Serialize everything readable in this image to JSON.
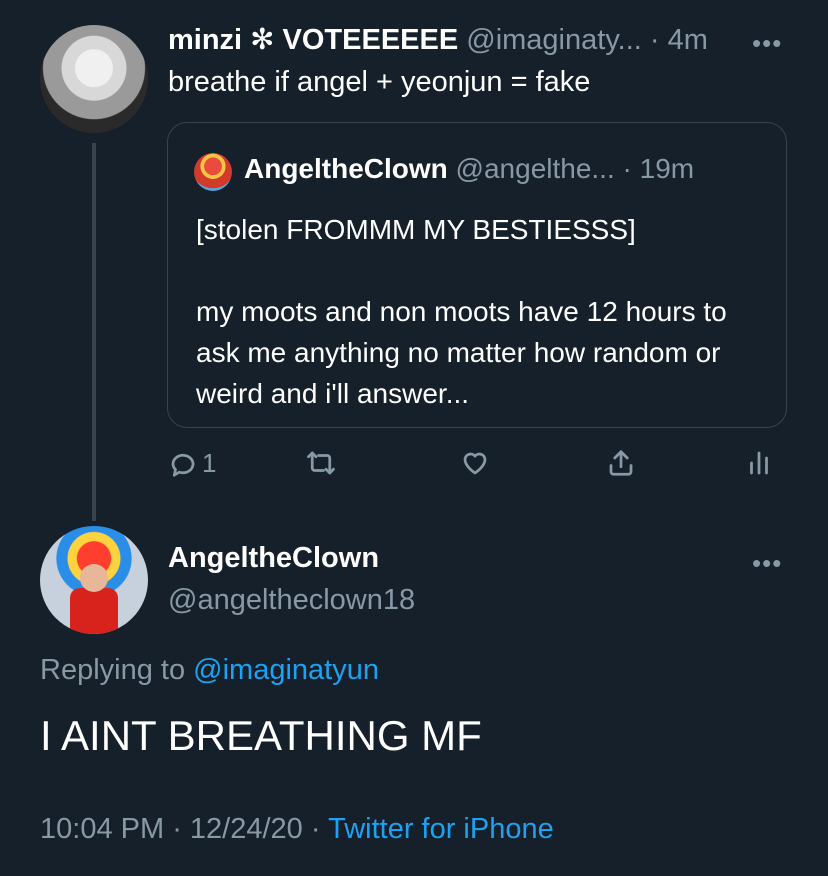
{
  "tweet": {
    "display_name": "minzi ✻ VOTEEEEEE",
    "handle": "@imaginaty...",
    "time": "· 4m",
    "text": "breathe if angel + yeonjun = fake",
    "more_icon": "more-horizontal-icon"
  },
  "quote": {
    "display_name": "AngeltheClown",
    "handle": "@angelthe...",
    "time": "· 19m",
    "text": "[stolen FROMMM MY BESTIESSS]\n\nmy moots and non moots have 12 hours to ask me anything no matter how random or weird and i'll answer..."
  },
  "actions": {
    "reply_count": "1",
    "icons": [
      "reply-icon",
      "retweet-icon",
      "like-icon",
      "share-icon",
      "analytics-icon"
    ]
  },
  "reply": {
    "display_name": "AngeltheClown",
    "handle": "@angeltheclown18",
    "replying_label": "Replying to",
    "replying_to": "@imaginatyun",
    "text": "I AINT BREATHING MF",
    "time": "10:04 PM",
    "date": "12/24/20",
    "source": "Twitter for iPhone",
    "more_icon": "more-horizontal-icon"
  },
  "colors": {
    "background": "#15202b",
    "muted": "#8899a6",
    "link": "#1da1f2",
    "border": "#38444d"
  }
}
